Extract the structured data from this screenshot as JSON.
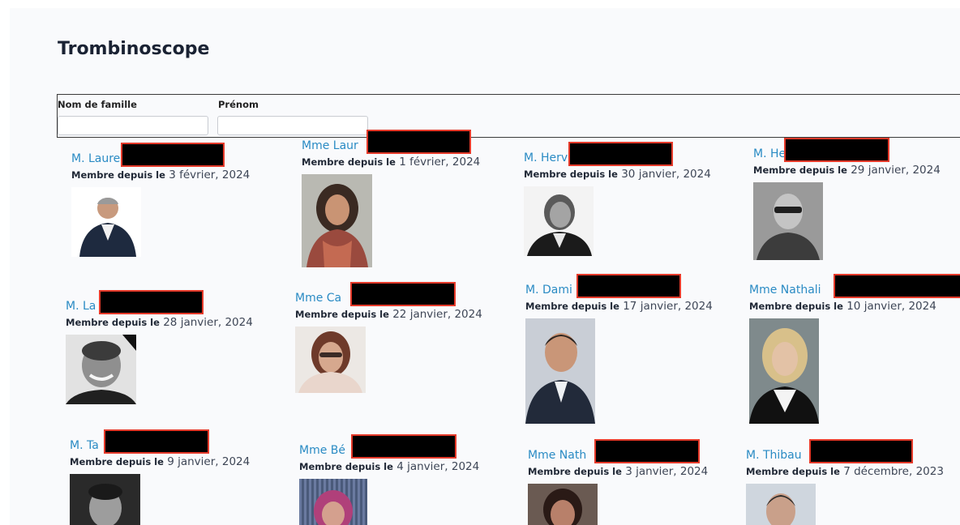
{
  "page": {
    "title": "Trombinoscope"
  },
  "filters": {
    "last_name_label": "Nom de famille",
    "first_name_label": "Prénom",
    "last_name_value": "",
    "first_name_value": ""
  },
  "member_since_label": "Membre depuis le",
  "members": [
    {
      "name": "M. Laure",
      "date": "3 février, 2024"
    },
    {
      "name": "Mme Laur",
      "date": "1 février, 2024"
    },
    {
      "name": "M. Herv",
      "date": "30 janvier, 2024"
    },
    {
      "name": "M. He",
      "date": "29 janvier, 2024"
    },
    {
      "name": "M. La",
      "date": "28 janvier, 2024"
    },
    {
      "name": "Mme Ca",
      "date": "22 janvier, 2024"
    },
    {
      "name": "M. Dami",
      "date": "17 janvier, 2024"
    },
    {
      "name": "Mme Nathali",
      "date": "10 janvier, 2024"
    },
    {
      "name": "M. Ta",
      "date": "9 janvier, 2024"
    },
    {
      "name": "Mme Bé",
      "date": "4 janvier, 2024"
    },
    {
      "name": "Mme Nath",
      "date": "3 janvier, 2024"
    },
    {
      "name": "M. Thibau",
      "date": "7 décembre, 2023"
    }
  ],
  "colors": {
    "link": "#2a8bc4",
    "redaction_border": "#e53a2a",
    "title": "#1a2233"
  }
}
